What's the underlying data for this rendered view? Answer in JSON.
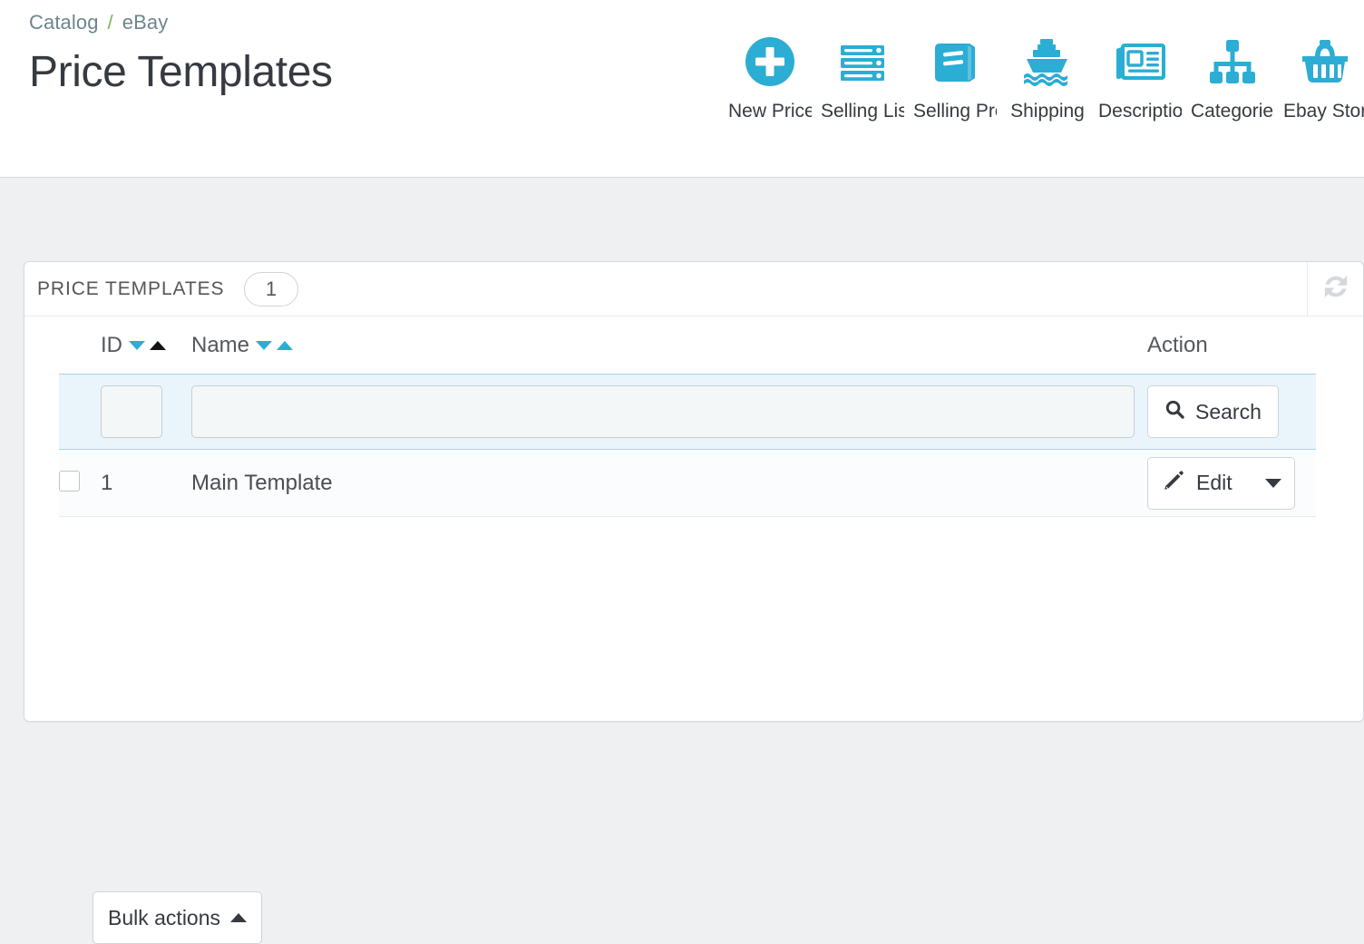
{
  "breadcrumb": {
    "items": [
      "Catalog",
      "eBay"
    ],
    "separator": "/"
  },
  "page": {
    "title": "Price Templates"
  },
  "toolbar": {
    "items": [
      {
        "label": "New Price Template",
        "icon": "plus-circle-icon"
      },
      {
        "label": "Selling Lists",
        "icon": "server-list-icon"
      },
      {
        "label": "Selling Profiles",
        "icon": "book-icon"
      },
      {
        "label": "Shipping",
        "icon": "ship-icon"
      },
      {
        "label": "Description",
        "icon": "newspaper-icon"
      },
      {
        "label": "Categories",
        "icon": "sitemap-icon"
      },
      {
        "label": "Ebay Store",
        "icon": "basket-icon"
      }
    ]
  },
  "panel": {
    "title": "PRICE TEMPLATES",
    "count": "1",
    "refresh_icon": "refresh-sync-icon"
  },
  "table": {
    "columns": [
      {
        "key": "id",
        "label": "ID",
        "sort_down_active": false,
        "sort_up_active": true
      },
      {
        "key": "name",
        "label": "Name",
        "sort_down_active": false,
        "sort_up_active": false
      },
      {
        "key": "action",
        "label": "Action"
      }
    ],
    "filters": {
      "id_value": "",
      "id_placeholder": "",
      "name_value": "",
      "name_placeholder": "",
      "search_label": "Search",
      "search_icon": "magnifier-icon"
    },
    "rows": [
      {
        "checked": false,
        "id": "1",
        "name": "Main Template",
        "action_label": "Edit",
        "action_icon": "pencil-icon",
        "action_caret": "chevron-down-icon"
      }
    ]
  },
  "footer": {
    "bulk_actions_label": "Bulk actions",
    "bulk_actions_caret": "chevron-up-icon"
  },
  "colors": {
    "accent_blue": "#2badd4",
    "breadcrumb_green": "#7ab55c",
    "filter_row_bg": "#eaf4fb",
    "filter_row_border": "#a4d4ea",
    "text_dark": "#363a41",
    "page_bg": "#eef0f1"
  }
}
